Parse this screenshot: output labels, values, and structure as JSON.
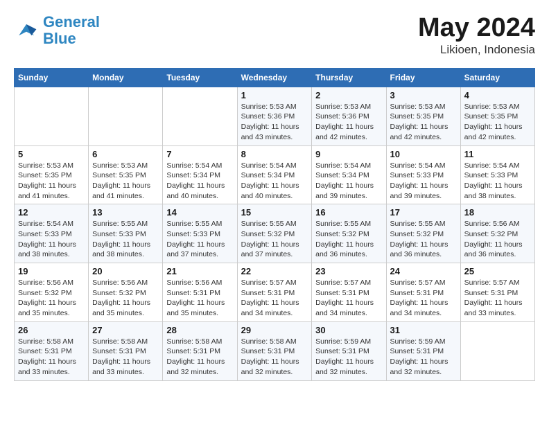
{
  "logo": {
    "line1": "General",
    "line2": "Blue"
  },
  "title": "May 2024",
  "location": "Likioen, Indonesia",
  "days_header": [
    "Sunday",
    "Monday",
    "Tuesday",
    "Wednesday",
    "Thursday",
    "Friday",
    "Saturday"
  ],
  "weeks": [
    [
      {
        "num": "",
        "info": ""
      },
      {
        "num": "",
        "info": ""
      },
      {
        "num": "",
        "info": ""
      },
      {
        "num": "1",
        "info": "Sunrise: 5:53 AM\nSunset: 5:36 PM\nDaylight: 11 hours\nand 43 minutes."
      },
      {
        "num": "2",
        "info": "Sunrise: 5:53 AM\nSunset: 5:36 PM\nDaylight: 11 hours\nand 42 minutes."
      },
      {
        "num": "3",
        "info": "Sunrise: 5:53 AM\nSunset: 5:35 PM\nDaylight: 11 hours\nand 42 minutes."
      },
      {
        "num": "4",
        "info": "Sunrise: 5:53 AM\nSunset: 5:35 PM\nDaylight: 11 hours\nand 42 minutes."
      }
    ],
    [
      {
        "num": "5",
        "info": "Sunrise: 5:53 AM\nSunset: 5:35 PM\nDaylight: 11 hours\nand 41 minutes."
      },
      {
        "num": "6",
        "info": "Sunrise: 5:53 AM\nSunset: 5:35 PM\nDaylight: 11 hours\nand 41 minutes."
      },
      {
        "num": "7",
        "info": "Sunrise: 5:54 AM\nSunset: 5:34 PM\nDaylight: 11 hours\nand 40 minutes."
      },
      {
        "num": "8",
        "info": "Sunrise: 5:54 AM\nSunset: 5:34 PM\nDaylight: 11 hours\nand 40 minutes."
      },
      {
        "num": "9",
        "info": "Sunrise: 5:54 AM\nSunset: 5:34 PM\nDaylight: 11 hours\nand 39 minutes."
      },
      {
        "num": "10",
        "info": "Sunrise: 5:54 AM\nSunset: 5:33 PM\nDaylight: 11 hours\nand 39 minutes."
      },
      {
        "num": "11",
        "info": "Sunrise: 5:54 AM\nSunset: 5:33 PM\nDaylight: 11 hours\nand 38 minutes."
      }
    ],
    [
      {
        "num": "12",
        "info": "Sunrise: 5:54 AM\nSunset: 5:33 PM\nDaylight: 11 hours\nand 38 minutes."
      },
      {
        "num": "13",
        "info": "Sunrise: 5:55 AM\nSunset: 5:33 PM\nDaylight: 11 hours\nand 38 minutes."
      },
      {
        "num": "14",
        "info": "Sunrise: 5:55 AM\nSunset: 5:33 PM\nDaylight: 11 hours\nand 37 minutes."
      },
      {
        "num": "15",
        "info": "Sunrise: 5:55 AM\nSunset: 5:32 PM\nDaylight: 11 hours\nand 37 minutes."
      },
      {
        "num": "16",
        "info": "Sunrise: 5:55 AM\nSunset: 5:32 PM\nDaylight: 11 hours\nand 36 minutes."
      },
      {
        "num": "17",
        "info": "Sunrise: 5:55 AM\nSunset: 5:32 PM\nDaylight: 11 hours\nand 36 minutes."
      },
      {
        "num": "18",
        "info": "Sunrise: 5:56 AM\nSunset: 5:32 PM\nDaylight: 11 hours\nand 36 minutes."
      }
    ],
    [
      {
        "num": "19",
        "info": "Sunrise: 5:56 AM\nSunset: 5:32 PM\nDaylight: 11 hours\nand 35 minutes."
      },
      {
        "num": "20",
        "info": "Sunrise: 5:56 AM\nSunset: 5:32 PM\nDaylight: 11 hours\nand 35 minutes."
      },
      {
        "num": "21",
        "info": "Sunrise: 5:56 AM\nSunset: 5:31 PM\nDaylight: 11 hours\nand 35 minutes."
      },
      {
        "num": "22",
        "info": "Sunrise: 5:57 AM\nSunset: 5:31 PM\nDaylight: 11 hours\nand 34 minutes."
      },
      {
        "num": "23",
        "info": "Sunrise: 5:57 AM\nSunset: 5:31 PM\nDaylight: 11 hours\nand 34 minutes."
      },
      {
        "num": "24",
        "info": "Sunrise: 5:57 AM\nSunset: 5:31 PM\nDaylight: 11 hours\nand 34 minutes."
      },
      {
        "num": "25",
        "info": "Sunrise: 5:57 AM\nSunset: 5:31 PM\nDaylight: 11 hours\nand 33 minutes."
      }
    ],
    [
      {
        "num": "26",
        "info": "Sunrise: 5:58 AM\nSunset: 5:31 PM\nDaylight: 11 hours\nand 33 minutes."
      },
      {
        "num": "27",
        "info": "Sunrise: 5:58 AM\nSunset: 5:31 PM\nDaylight: 11 hours\nand 33 minutes."
      },
      {
        "num": "28",
        "info": "Sunrise: 5:58 AM\nSunset: 5:31 PM\nDaylight: 11 hours\nand 32 minutes."
      },
      {
        "num": "29",
        "info": "Sunrise: 5:58 AM\nSunset: 5:31 PM\nDaylight: 11 hours\nand 32 minutes."
      },
      {
        "num": "30",
        "info": "Sunrise: 5:59 AM\nSunset: 5:31 PM\nDaylight: 11 hours\nand 32 minutes."
      },
      {
        "num": "31",
        "info": "Sunrise: 5:59 AM\nSunset: 5:31 PM\nDaylight: 11 hours\nand 32 minutes."
      },
      {
        "num": "",
        "info": ""
      }
    ]
  ]
}
